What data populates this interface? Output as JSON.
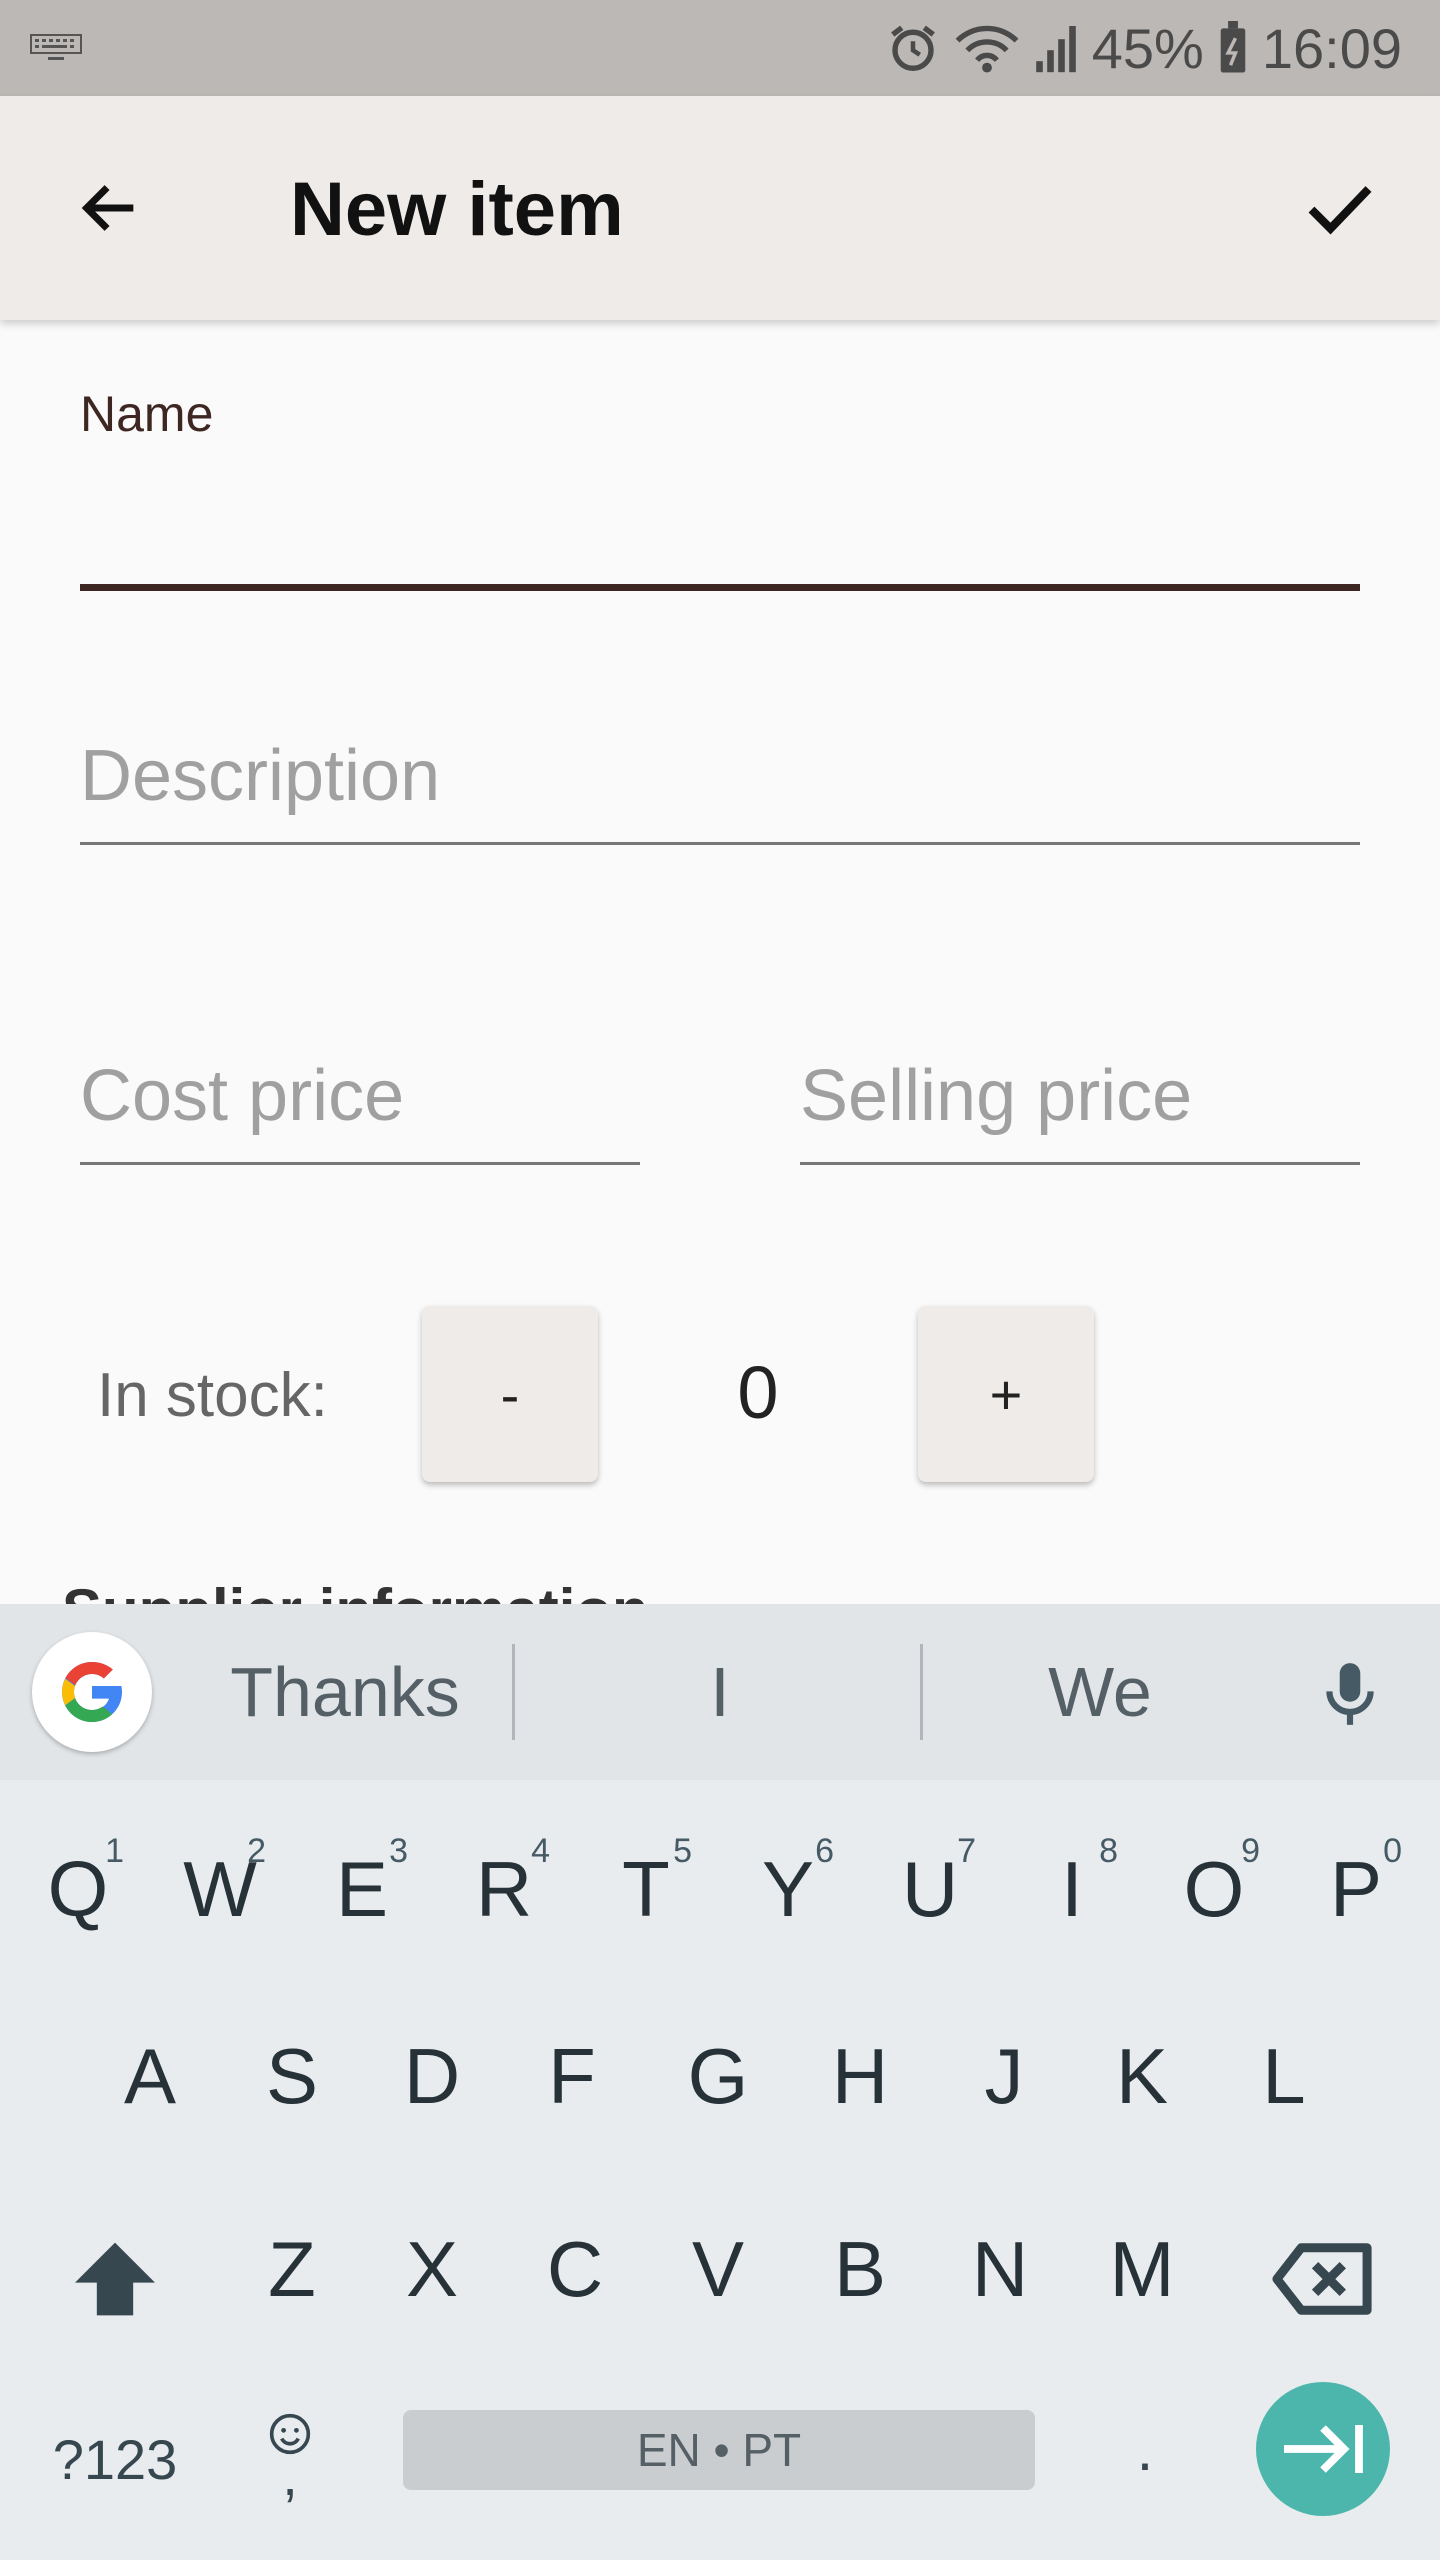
{
  "status_bar": {
    "battery": "45%",
    "time": "16:09",
    "icons": [
      "keyboard-icon",
      "alarm-icon",
      "wifi-icon",
      "signal-icon",
      "battery-icon"
    ]
  },
  "app_bar": {
    "title": "New item",
    "back_icon": "arrow-back-icon",
    "confirm_icon": "check-icon"
  },
  "form": {
    "name_label": "Name",
    "name_value": "",
    "description_placeholder": "Description",
    "cost_price_placeholder": "Cost price",
    "selling_price_placeholder": "Selling price",
    "stock_label": "In stock:",
    "stock_minus": "-",
    "stock_value": "0",
    "stock_plus": "+",
    "partial_heading": "Supplier information"
  },
  "keyboard": {
    "suggestions": [
      "Thanks",
      "I",
      "We"
    ],
    "row1": [
      {
        "key": "Q",
        "hint": "1"
      },
      {
        "key": "W",
        "hint": "2"
      },
      {
        "key": "E",
        "hint": "3"
      },
      {
        "key": "R",
        "hint": "4"
      },
      {
        "key": "T",
        "hint": "5"
      },
      {
        "key": "Y",
        "hint": "6"
      },
      {
        "key": "U",
        "hint": "7"
      },
      {
        "key": "I",
        "hint": "8"
      },
      {
        "key": "O",
        "hint": "9"
      },
      {
        "key": "P",
        "hint": "0"
      }
    ],
    "row2": [
      "A",
      "S",
      "D",
      "F",
      "G",
      "H",
      "J",
      "K",
      "L"
    ],
    "row3": [
      "Z",
      "X",
      "C",
      "V",
      "B",
      "N",
      "M"
    ],
    "symbols_key": "?123",
    "comma_key": ",",
    "space_label": "EN • PT",
    "period_key": ".",
    "accent_color": "#4db6ac"
  }
}
